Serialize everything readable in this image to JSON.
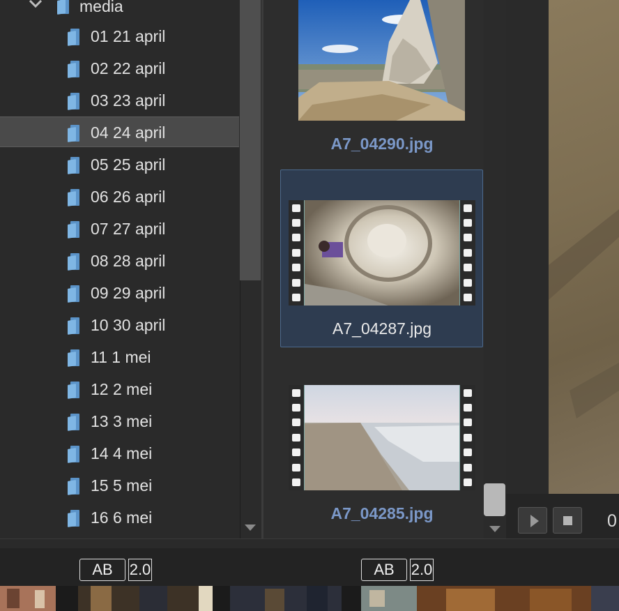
{
  "tree": {
    "parent_folder": "media",
    "folders": [
      {
        "label": "01 21 april",
        "selected": false
      },
      {
        "label": "02 22 april",
        "selected": false
      },
      {
        "label": "03 23 april",
        "selected": false
      },
      {
        "label": "04 24 april",
        "selected": true
      },
      {
        "label": "05 25 april",
        "selected": false
      },
      {
        "label": "06 26 april",
        "selected": false
      },
      {
        "label": "07 27 april",
        "selected": false
      },
      {
        "label": "08 28 april",
        "selected": false
      },
      {
        "label": "09 29 april",
        "selected": false
      },
      {
        "label": "10 30 april",
        "selected": false
      },
      {
        "label": "11 1 mei",
        "selected": false
      },
      {
        "label": "12 2 mei",
        "selected": false
      },
      {
        "label": "13 3 mei",
        "selected": false
      },
      {
        "label": "14 4 mei",
        "selected": false
      },
      {
        "label": "15 5 mei",
        "selected": false
      },
      {
        "label": "16 6 mei",
        "selected": false
      }
    ]
  },
  "thumbnails": [
    {
      "filename": "A7_04290.jpg",
      "kind": "photo",
      "selected": false
    },
    {
      "filename": "A7_04287.jpg",
      "kind": "video",
      "selected": true
    },
    {
      "filename": "A7_04285.jpg",
      "kind": "video",
      "selected": false
    }
  ],
  "preview": {
    "counter": "0"
  },
  "bottom_bar": {
    "left": {
      "ab": "AB",
      "version": "2.0"
    },
    "right": {
      "ab": "AB",
      "version": "2.0"
    }
  },
  "colors": {
    "folder_icon": "#7fb6e4",
    "label_blue": "#7b98c8",
    "selection": "#2e3c50"
  }
}
